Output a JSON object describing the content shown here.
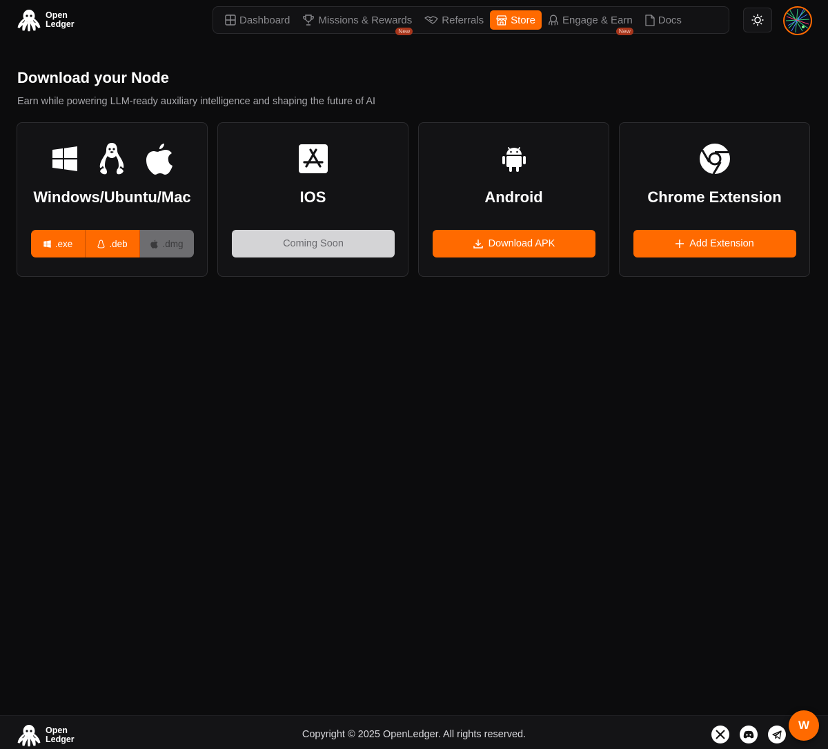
{
  "brand": {
    "line1": "Open",
    "line2": "Ledger"
  },
  "nav": [
    {
      "label": "Dashboard",
      "icon": "dashboard-grid-icon",
      "badge": ""
    },
    {
      "label": "Missions & Rewards",
      "icon": "trophy-icon",
      "badge": "New"
    },
    {
      "label": "Referrals",
      "icon": "handshake-icon",
      "badge": ""
    },
    {
      "label": "Store",
      "icon": "store-icon",
      "badge": "",
      "active": true
    },
    {
      "label": "Engage & Earn",
      "icon": "octopus-icon",
      "badge": "New"
    },
    {
      "label": "Docs",
      "icon": "document-icon",
      "badge": ""
    }
  ],
  "page": {
    "title": "Download your Node",
    "subtitle": "Earn while powering LLM-ready auxiliary intelligence and shaping the future of AI"
  },
  "cards": {
    "desktop": {
      "title": "Windows/Ubuntu/Mac",
      "icons": [
        "windows-icon",
        "linux-tux-icon",
        "apple-icon"
      ],
      "buttons": [
        {
          "label": ".exe",
          "icon": "windows-icon"
        },
        {
          "label": ".deb",
          "icon": "linux-tux-icon"
        },
        {
          "label": ".dmg",
          "icon": "apple-icon",
          "disabled": true
        }
      ]
    },
    "ios": {
      "title": "IOS",
      "icon": "app-store-icon",
      "button": "Coming Soon"
    },
    "android": {
      "title": "Android",
      "icon": "android-icon",
      "button": "Download APK"
    },
    "chrome": {
      "title": "Chrome Extension",
      "icon": "chrome-icon",
      "button": "Add Extension"
    }
  },
  "footer": {
    "copyright": "Copyright © 2025 OpenLedger. All rights reserved.",
    "social": [
      "x-icon",
      "discord-icon",
      "telegram-icon"
    ]
  },
  "fab": {
    "label": "W"
  },
  "colors": {
    "accent": "#ff6a00",
    "background": "#0c0c0d",
    "card": "#131315"
  }
}
